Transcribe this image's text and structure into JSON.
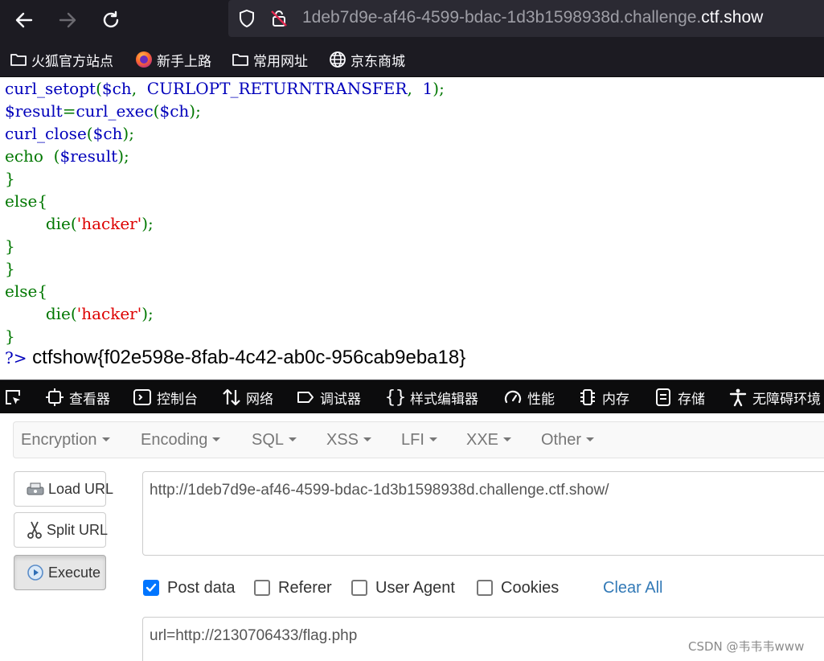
{
  "browser": {
    "url_prefix": "1deb7d9e-af46-4599-bdac-1d3b1598938d.challenge.",
    "url_domain": "ctf.show",
    "bookmarks": [
      {
        "label": "火狐官方站点",
        "icon": "folder-icon"
      },
      {
        "label": "新手上路",
        "icon": "firefox-icon"
      },
      {
        "label": "常用网址",
        "icon": "folder-icon"
      },
      {
        "label": "京东商城",
        "icon": "globe-icon"
      }
    ]
  },
  "page": {
    "code_lines": [
      [
        {
          "t": "curl_setopt",
          "c": "blue"
        },
        {
          "t": "(",
          "c": "green"
        },
        {
          "t": "$ch",
          "c": "blue"
        },
        {
          "t": ",  ",
          "c": "green"
        },
        {
          "t": "CURLOPT_RETURNTRANSFER",
          "c": "blue"
        },
        {
          "t": ",  ",
          "c": "green"
        },
        {
          "t": "1",
          "c": "blue"
        },
        {
          "t": ");",
          "c": "green"
        }
      ],
      [
        {
          "t": "$result",
          "c": "blue"
        },
        {
          "t": "=",
          "c": "green"
        },
        {
          "t": "curl_exec",
          "c": "blue"
        },
        {
          "t": "(",
          "c": "green"
        },
        {
          "t": "$ch",
          "c": "blue"
        },
        {
          "t": ");",
          "c": "green"
        }
      ],
      [
        {
          "t": "curl_close",
          "c": "blue"
        },
        {
          "t": "(",
          "c": "green"
        },
        {
          "t": "$ch",
          "c": "blue"
        },
        {
          "t": ");",
          "c": "green"
        }
      ],
      [
        {
          "t": "echo  (",
          "c": "green"
        },
        {
          "t": "$result",
          "c": "blue"
        },
        {
          "t": ");",
          "c": "green"
        }
      ],
      [
        {
          "t": "}",
          "c": "green"
        }
      ],
      [
        {
          "t": "else{",
          "c": "green"
        }
      ],
      [
        {
          "t": "        die(",
          "c": "green"
        },
        {
          "t": "'hacker'",
          "c": "red"
        },
        {
          "t": ");",
          "c": "green"
        }
      ],
      [
        {
          "t": "}",
          "c": "green"
        }
      ],
      [
        {
          "t": "}",
          "c": "green"
        }
      ],
      [
        {
          "t": "else{",
          "c": "green"
        }
      ],
      [
        {
          "t": "        die(",
          "c": "green"
        },
        {
          "t": "'hacker'",
          "c": "red"
        },
        {
          "t": ");",
          "c": "green"
        }
      ],
      [
        {
          "t": "}",
          "c": "green"
        }
      ]
    ],
    "closing_tag": "?>",
    "flag": "ctfshow{f02e598e-8fab-4c42-ab0c-956cab9eba18}"
  },
  "devtools": {
    "tabs": [
      {
        "label": "查看器",
        "icon": "inspector-icon"
      },
      {
        "label": "控制台",
        "icon": "console-icon"
      },
      {
        "label": "网络",
        "icon": "network-icon"
      },
      {
        "label": "调试器",
        "icon": "debugger-icon"
      },
      {
        "label": "样式编辑器",
        "icon": "style-editor-icon"
      },
      {
        "label": "性能",
        "icon": "performance-icon"
      },
      {
        "label": "内存",
        "icon": "memory-icon"
      },
      {
        "label": "存储",
        "icon": "storage-icon"
      },
      {
        "label": "无障碍环境",
        "icon": "accessibility-icon"
      }
    ]
  },
  "hackbar": {
    "menus": [
      "Encryption",
      "Encoding",
      "SQL",
      "XSS",
      "LFI",
      "XXE",
      "Other"
    ],
    "load_url": "Load URL",
    "split_url": "Split URL",
    "execute": "Execute",
    "url_value": "http://1deb7d9e-af46-4599-bdac-1d3b1598938d.challenge.ctf.show/",
    "options": [
      {
        "label": "Post data",
        "checked": true
      },
      {
        "label": "Referer",
        "checked": false
      },
      {
        "label": "User Agent",
        "checked": false
      },
      {
        "label": "Cookies",
        "checked": false
      }
    ],
    "clear_all": "Clear All",
    "post_value": "url=http://2130706433/flag.php"
  },
  "watermark": "CSDN @韦韦韦www"
}
